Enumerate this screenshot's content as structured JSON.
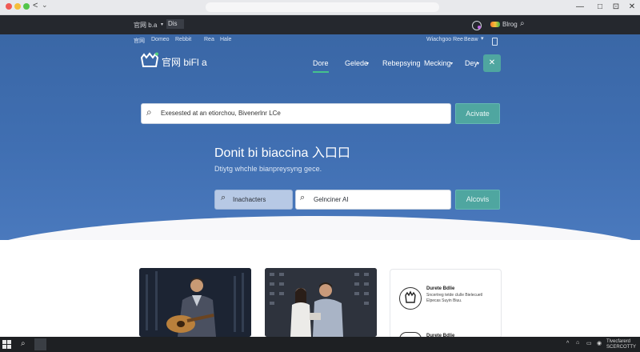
{
  "browser": {
    "tab_title": "",
    "back_label": "<",
    "forward_label": "⌄",
    "window_controls": [
      "—",
      "□",
      "⊡",
      "✕"
    ]
  },
  "topbar": {
    "site_label": "官网 b.a",
    "site_sub": "Dis",
    "account_label": "Blrog",
    "sublinks": [
      "官网",
      "Domeo",
      "Rebbit",
      "Rea",
      "Hale"
    ],
    "right_links": [
      "Wiachgoo Ree",
      "Beaw"
    ]
  },
  "nav": {
    "logo_text": "官网 biFl a",
    "links": [
      "Dore",
      "Gelede",
      "Rebepsying",
      "Mecking",
      "Dey"
    ],
    "active_index": 0,
    "close_label": "✕"
  },
  "search": {
    "query": "Exesested at an etiorchou, Bivenerlnr LCe",
    "button": "Acivate"
  },
  "hero": {
    "title": "Donit bi biaccina 入口口",
    "subtitle": "Dtiytg whchle bianpreysyng gece.",
    "chip_left": "Inachacters",
    "chip_middle": "Gelnciner AI",
    "button_right": "Alcovis"
  },
  "side_card": {
    "title1": "Durete Bdlie",
    "desc1": "Sncertreg tetde clulle Bielecuetl Elpecas Suyin Biuu.",
    "title2": "Durete Bdlie"
  },
  "taskbar": {
    "clock_line1": "Tlvecfarerd",
    "clock_line2": "SCERCOTTY"
  },
  "colors": {
    "hero": "#3f6db0",
    "accent_teal": "#4fa6a0",
    "active_underline": "#45c28c",
    "dark_bar": "#25282e"
  }
}
